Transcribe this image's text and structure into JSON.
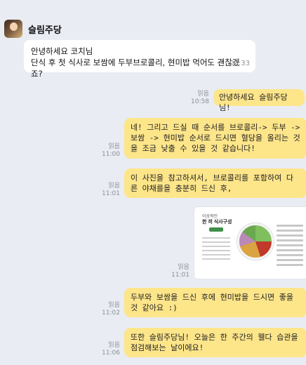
{
  "header": {
    "sender_name": "슬림주당"
  },
  "incoming": {
    "lines": [
      "안녕하세요 코치님",
      "단식 후 첫 식사로 보쌈에 두부브로콜리, 현미밥 먹어도 괜찮겠죠?"
    ],
    "time": "09:33"
  },
  "outgoing": [
    {
      "read": "읽음",
      "time": "10:58",
      "text": "안녕하세요 슬림주당님!"
    },
    {
      "read": "읽음",
      "time": "11:00",
      "text": "네! 그리고 드실 때 순서를 브로콜리-> 두부 -> 보쌈 -> 현미밥 순서로 드시면 혈당을 올리는 것을 조금 낮출 수 있을 것 같습니다!"
    },
    {
      "read": "읽음",
      "time": "11:01",
      "text": "이 사진을 참고하셔서, 브로콜리를 포함하여 다른 야채를을 충분히 드신 후,"
    },
    {
      "read": "읽음",
      "time": "11:01",
      "image": {
        "title": "이상적인",
        "subtitle": "한 끼 식사구성"
      }
    },
    {
      "read": "읽음",
      "time": "11:02",
      "text": "두부와 보쌈을 드신 후에 현미밥을 드시면 좋을 것 같아요 :)"
    },
    {
      "read": "읽음",
      "time": "11:06",
      "text": "또한 슬림주당님! 오늘은 한 주간의 웰다 습관을 점검해보는 날이에요!"
    }
  ]
}
